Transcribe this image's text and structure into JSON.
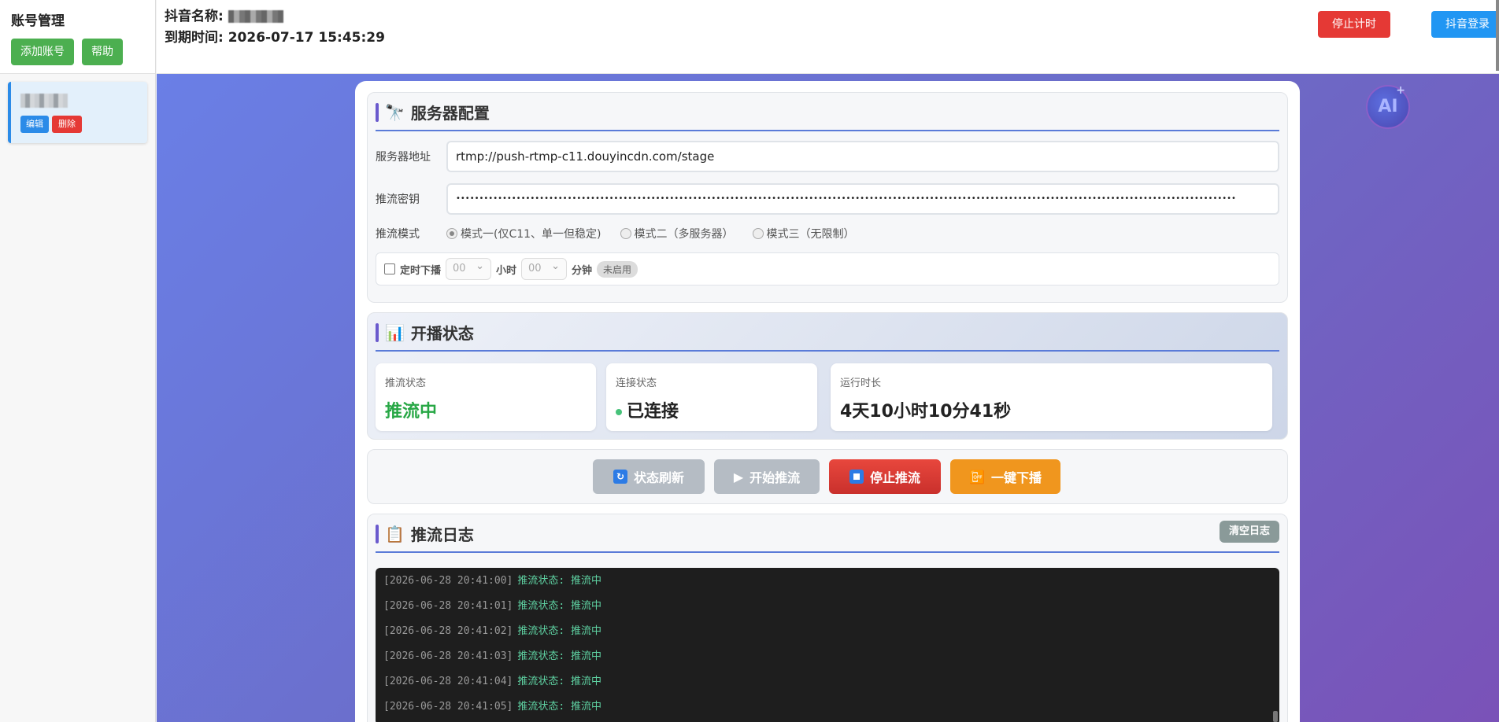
{
  "sidebar": {
    "title": "账号管理",
    "add_button": "添加账号",
    "help_button": "帮助",
    "account": {
      "edit": "编辑",
      "delete": "删除"
    }
  },
  "header": {
    "name_label": "抖音名称:",
    "expire": "到期时间: 2026-07-17 15:45:29",
    "stop_timer": "停止计时",
    "login": "抖音登录"
  },
  "badge": {
    "text": "AI",
    "plus": "+"
  },
  "server": {
    "title": "服务器配置",
    "address_label": "服务器地址",
    "address_value": "rtmp://push-rtmp-c11.douyincdn.com/stage",
    "key_label": "推流密钥",
    "key_value": "••••••••••••••••••••••••••••••••••••••••••••••••••••••••••••••••••••••••••••••••••••••••••••••••••••••••••••••••••••••••••••••••••••••••••••••••••••••••••••••••••••••••",
    "mode_label": "推流模式",
    "modes": [
      "模式一(仅C11、单一但稳定)",
      "模式二（多服务器）",
      "模式三（无限制）"
    ],
    "timer": {
      "label": "定时下播",
      "hour_value": "00",
      "hour_unit": "小时",
      "min_value": "00",
      "min_unit": "分钟",
      "status": "未启用"
    }
  },
  "status": {
    "title": "开播状态",
    "push_label": "推流状态",
    "push_value": "推流中",
    "conn_label": "连接状态",
    "conn_value": "已连接",
    "run_label": "运行时长",
    "run_value": "4天10小时10分41秒"
  },
  "actions": {
    "refresh": "状态刷新",
    "start": "开始推流",
    "stop": "停止推流",
    "offline": "一键下播"
  },
  "log": {
    "title": "推流日志",
    "clear": "清空日志",
    "lines": [
      {
        "ts": "[2026-06-28 20:41:00]",
        "msg": "推流状态: 推流中"
      },
      {
        "ts": "[2026-06-28 20:41:01]",
        "msg": "推流状态: 推流中"
      },
      {
        "ts": "[2026-06-28 20:41:02]",
        "msg": "推流状态: 推流中"
      },
      {
        "ts": "[2026-06-28 20:41:03]",
        "msg": "推流状态: 推流中"
      },
      {
        "ts": "[2026-06-28 20:41:04]",
        "msg": "推流状态: 推流中"
      },
      {
        "ts": "[2026-06-28 20:41:05]",
        "msg": "推流状态: 推流中"
      }
    ]
  },
  "colors": {
    "green": "#4caf50",
    "red": "#e53935",
    "blue": "#2196f3",
    "orange": "#f0961e",
    "gray_btn": "#b5bcc4"
  }
}
